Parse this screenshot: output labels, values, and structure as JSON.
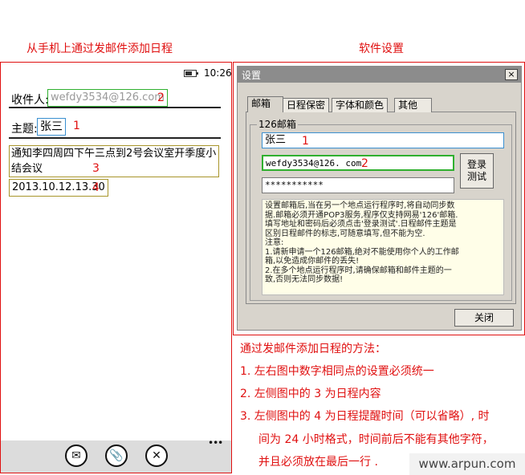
{
  "titles": {
    "left": "从手机上通过发邮件添加日程",
    "right": "软件设置"
  },
  "phone": {
    "time": "10:26",
    "to_label": "收件人:",
    "to_value": "wefdy3534@126.com",
    "subject_label": "主题:",
    "subject_value": "张三",
    "body_text": "通知李四周四下午三点到2号会议室开季度小结会议",
    "datetime": "2013.10.12.13.30",
    "more": "•••"
  },
  "markers": [
    "1",
    "2",
    "3",
    "4"
  ],
  "dialog": {
    "title": "设置",
    "close_x": "×",
    "tabs": [
      "邮箱",
      "日程保密",
      "字体和颜色",
      "其他"
    ],
    "group_label": "126邮箱",
    "subject_value": "张三",
    "email_value": "wefdy3534@126. com",
    "password_value": "***********",
    "login_button": [
      "登录",
      "测试"
    ],
    "note_lines": [
      "设置邮箱后,当在另一个地点运行程序时,将自动同步数",
      "据.邮箱必须开通POP3服务,程序仅支持网易'126'邮箱.",
      "填写地址和密码后必须点击'登录测试'.日程邮件主题是",
      "区别日程邮件的标志,可随意填写,但不能为空.",
      "注意:",
      "1.请新申请一个126邮箱,绝对不能使用你个人的工作邮",
      "箱,以免造成你邮件的丢失!",
      "2.在多个地点运行程序时,请确保邮箱和邮件主题的一",
      "致,否则无法同步数据!"
    ],
    "close_button": "关闭"
  },
  "instructions": {
    "heading": "通过发邮件添加日程的方法：",
    "items": [
      "1.  左右图中数字相同点的设置必须统一",
      "2.  左侧图中的 3 为日程内容",
      "3.  左侧图中的 4 为日程提醒时间（可以省略）, 时",
      "间为 24 小时格式，时间前后不能有其他字符，",
      "并且必须放在最后一行 ."
    ]
  },
  "watermark": "www.arpun.com",
  "colors": {
    "red_text": "#e01010",
    "box_blue": "#3a8fd0",
    "box_green": "#2fb02f",
    "box_olive": "#a8952a",
    "dialog_gray": "#d8d4cc",
    "note_bg": "#fffee8"
  },
  "icons": [
    "battery-icon",
    "compose-email-icon",
    "attach-icon",
    "cancel-icon",
    "more-icon"
  ]
}
